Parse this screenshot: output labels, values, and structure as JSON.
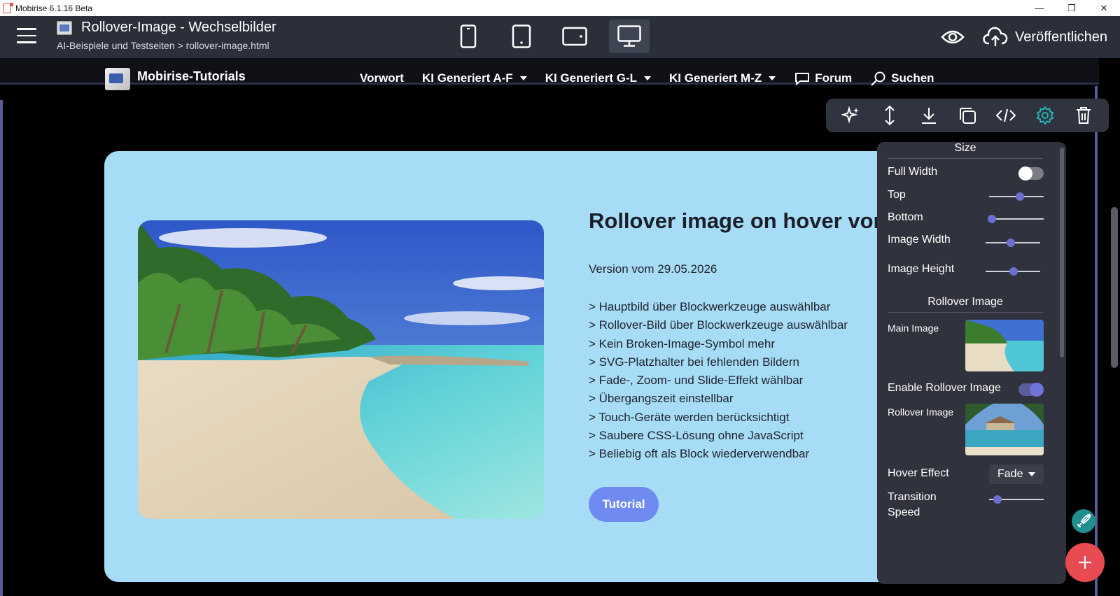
{
  "window": {
    "title": "Mobirise 6.1.16 Beta"
  },
  "topbar": {
    "title": "Rollover-Image - Wechselbilder",
    "path": "AI-Beispiele und Testseiten > rollover-image.html",
    "publish_label": "Veröffentlichen",
    "devices": [
      "phone-icon",
      "tablet-icon",
      "tablet-landscape-icon",
      "desktop-icon"
    ],
    "active_device": "desktop-icon"
  },
  "site_nav": {
    "brand": "Mobirise-Tutorials",
    "items": [
      {
        "label": "Vorwort",
        "dropdown": false
      },
      {
        "label": "KI Generiert A-F",
        "dropdown": true
      },
      {
        "label": "KI Generiert G-L",
        "dropdown": true
      },
      {
        "label": "KI Generiert M-Z",
        "dropdown": true
      },
      {
        "label": "Forum",
        "icon": "chat-icon"
      },
      {
        "label": "Suchen",
        "icon": "search-icon"
      }
    ]
  },
  "block_toolbar": {
    "icons": [
      "ai-sparkle-icon",
      "move-icon",
      "download-icon",
      "duplicate-icon",
      "code-icon",
      "gear-icon",
      "trash-icon"
    ],
    "active": "gear-icon",
    "accent": "#2bb1b1"
  },
  "content": {
    "heading": "Rollover image on hover vor",
    "version": "Version vom 29.05.2026",
    "bullets": [
      "> Hauptbild über Blockwerkzeuge auswählbar",
      "> Rollover-Bild über Blockwerkzeuge auswählbar",
      "> Kein Broken-Image-Symbol mehr",
      "> SVG-Platzhalter bei fehlenden Bildern",
      "> Fade-, Zoom- und Slide-Effekt wählbar",
      "> Übergangszeit einstellbar",
      "> Touch-Geräte werden berücksichtigt",
      "> Saubere CSS-Lösung ohne JavaScript",
      "> Beliebig oft als Block wiederverwendbar"
    ],
    "button": "Tutorial",
    "card_color": "#a6dcf6",
    "button_color": "#6f8bf2"
  },
  "panel": {
    "size_heading": "Size",
    "full_width": {
      "label": "Full Width",
      "on": false
    },
    "top": {
      "label": "Top",
      "value": 0.55
    },
    "bottom": {
      "label": "Bottom",
      "value": 0.0
    },
    "image_width": {
      "label": "Image Width",
      "value": 0.45
    },
    "image_height": {
      "label": "Image Height",
      "value": 0.5
    },
    "rollover_heading": "Rollover Image",
    "main_image_label": "Main Image",
    "enable_rollover": {
      "label": "Enable Rollover Image",
      "on": true
    },
    "rollover_image_label": "Rollover Image",
    "hover_effect": {
      "label": "Hover Effect",
      "value": "Fade"
    },
    "transition": {
      "label_line1": "Transition",
      "label_line2": "Speed",
      "value": 0.1
    }
  }
}
